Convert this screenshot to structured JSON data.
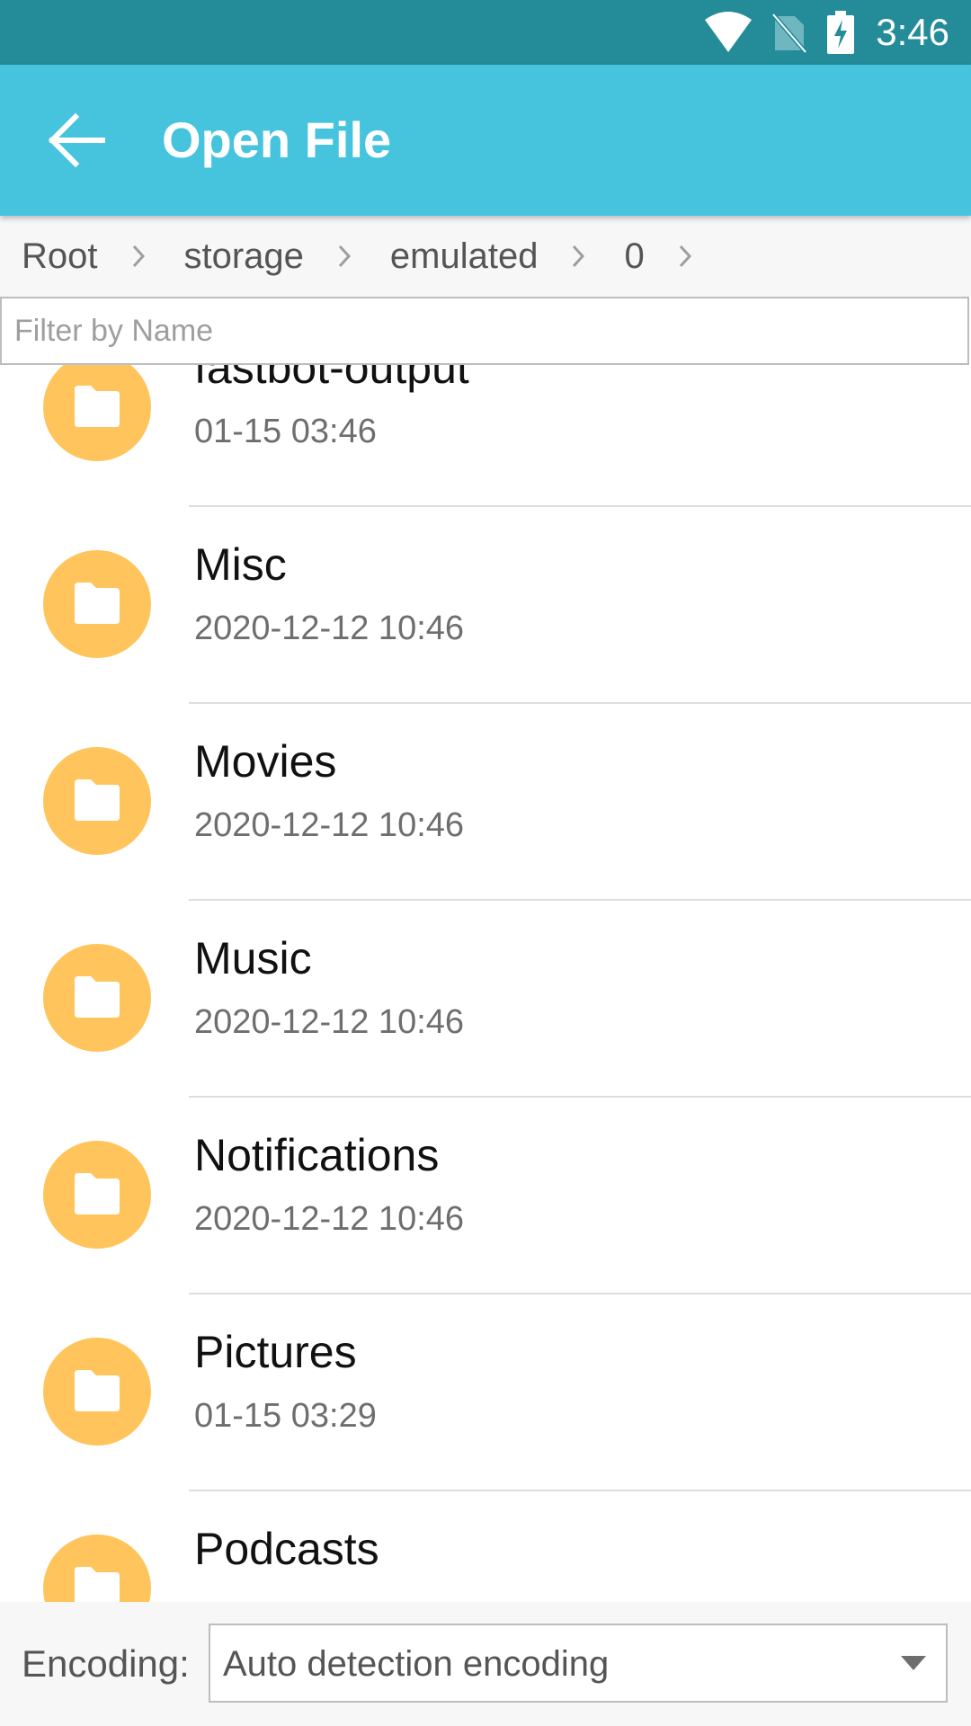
{
  "status_bar": {
    "time": "3:46",
    "icons": [
      "wifi-icon",
      "no-sim-icon",
      "battery-charging-icon"
    ]
  },
  "app_bar": {
    "back_icon": "arrow-back-icon",
    "title": "Open File"
  },
  "breadcrumb": [
    "Root",
    "storage",
    "emulated",
    "0"
  ],
  "filter": {
    "placeholder": "Filter by Name",
    "value": ""
  },
  "files": [
    {
      "name": "fastbot-output",
      "date": "01-15 03:46"
    },
    {
      "name": "Misc",
      "date": "2020-12-12 10:46"
    },
    {
      "name": "Movies",
      "date": "2020-12-12 10:46"
    },
    {
      "name": "Music",
      "date": "2020-12-12 10:46"
    },
    {
      "name": "Notifications",
      "date": "2020-12-12 10:46"
    },
    {
      "name": "Pictures",
      "date": "01-15 03:29"
    },
    {
      "name": "Podcasts",
      "date": ""
    }
  ],
  "encoding": {
    "label": "Encoding:",
    "value": "Auto detection encoding"
  },
  "colors": {
    "status_bar": "#248b99",
    "app_bar": "#46c4de",
    "folder_icon_bg": "#ffc55c"
  }
}
